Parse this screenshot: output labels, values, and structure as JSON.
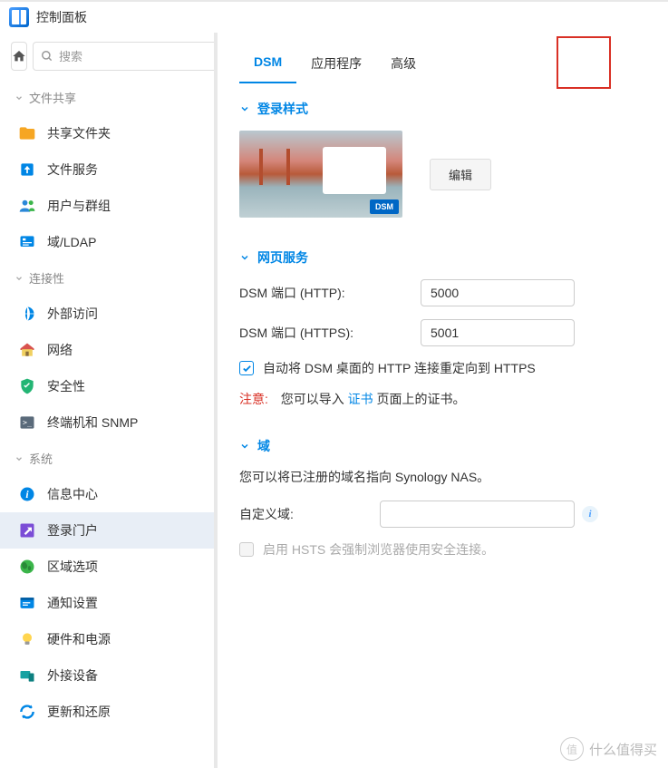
{
  "title": "控制面板",
  "search": {
    "placeholder": "搜索"
  },
  "categories": [
    {
      "key": "fileShare",
      "label": "文件共享",
      "items": [
        {
          "key": "sharedFolder",
          "label": "共享文件夹",
          "color": "#f6a623"
        },
        {
          "key": "fileService",
          "label": "文件服务",
          "color": "#0086e5"
        },
        {
          "key": "users",
          "label": "用户与群组",
          "color": "#2b88d8"
        },
        {
          "key": "ldap",
          "label": "域/LDAP",
          "color": "#0086e5"
        }
      ]
    },
    {
      "key": "connectivity",
      "label": "连接性",
      "items": [
        {
          "key": "external",
          "label": "外部访问",
          "color": "#0086e5"
        },
        {
          "key": "network",
          "label": "网络",
          "color": "#3bb54a"
        },
        {
          "key": "security",
          "label": "安全性",
          "color": "#23b574"
        },
        {
          "key": "terminal",
          "label": "终端机和 SNMP",
          "color": "#5a6a7a"
        }
      ]
    },
    {
      "key": "system",
      "label": "系统",
      "items": [
        {
          "key": "infoCenter",
          "label": "信息中心",
          "color": "#0086e5"
        },
        {
          "key": "loginPortal",
          "label": "登录门户",
          "color": "#7b4dd6",
          "active": true
        },
        {
          "key": "regional",
          "label": "区域选项",
          "color": "#3bb54a"
        },
        {
          "key": "notification",
          "label": "通知设置",
          "color": "#0086e5"
        },
        {
          "key": "hardware",
          "label": "硬件和电源",
          "color": "#f6a623"
        },
        {
          "key": "externalDevices",
          "label": "外接设备",
          "color": "#17a2a2"
        },
        {
          "key": "updateRestore",
          "label": "更新和还原",
          "color": "#0086e5"
        }
      ]
    }
  ],
  "tabs": {
    "dsm": "DSM",
    "apps": "应用程序",
    "advanced": "高级"
  },
  "sections": {
    "loginStyle": {
      "title": "登录样式",
      "editBtn": "编辑"
    },
    "webService": {
      "title": "网页服务",
      "httpLabel": "DSM 端口 (HTTP):",
      "httpValue": "5000",
      "httpsLabel": "DSM 端口 (HTTPS):",
      "httpsValue": "5001",
      "redirectLabel": "自动将 DSM 桌面的 HTTP 连接重定向到 HTTPS",
      "noteLabel": "注意:",
      "noteText1": "您可以导入 ",
      "noteLink": "证书",
      "noteText2": " 页面上的证书。"
    },
    "domain": {
      "title": "域",
      "desc": "您可以将已注册的域名指向 Synology NAS。",
      "customLabel": "自定义域:",
      "customValue": "",
      "hstsLabel": "启用 HSTS 会强制浏览器使用安全连接。"
    }
  },
  "watermark": "什么值得买"
}
